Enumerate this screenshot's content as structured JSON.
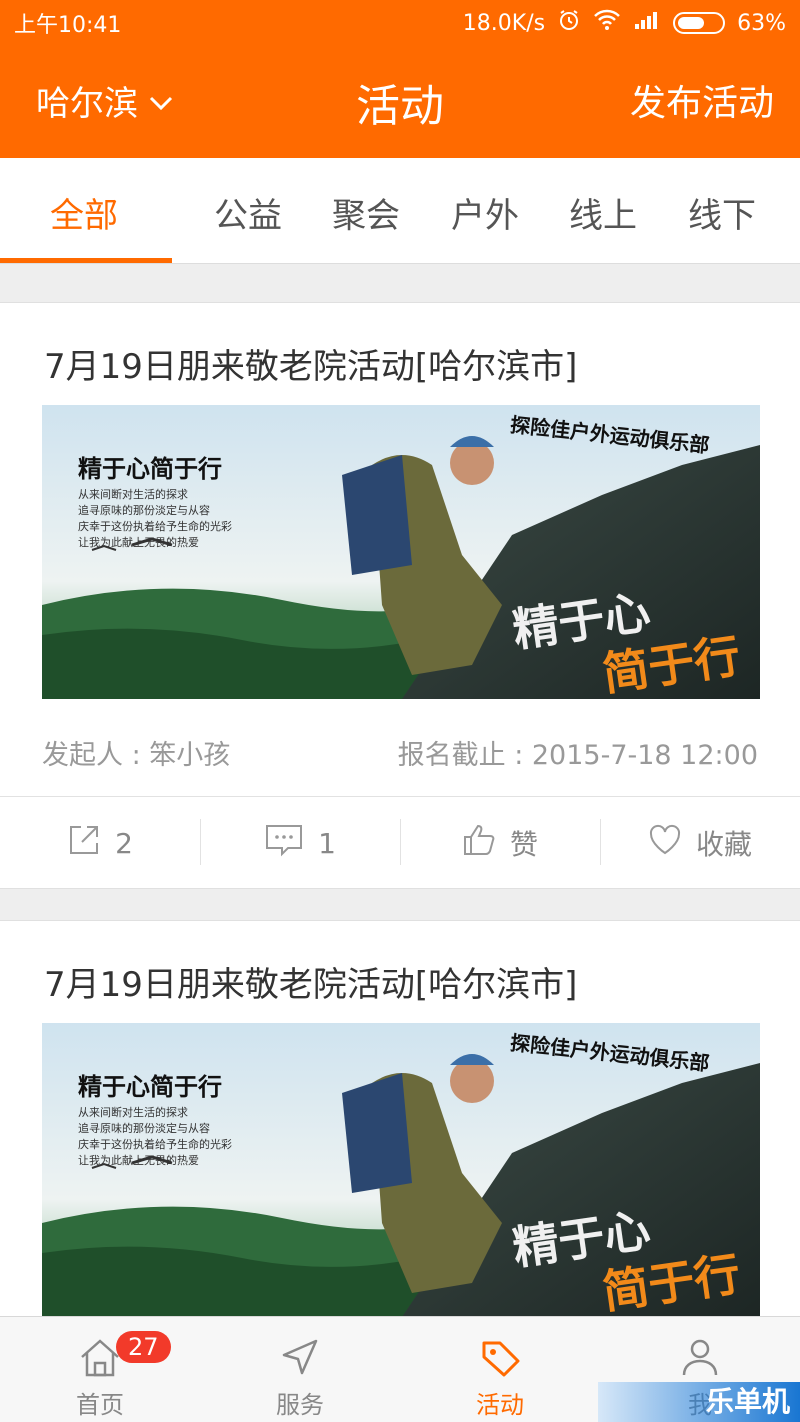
{
  "status_bar": {
    "time": "上午10:41",
    "speed": "18.0K/s",
    "battery": "63%",
    "battery_level": 0.63
  },
  "header": {
    "city": "哈尔滨",
    "title": "活动",
    "publish": "发布活动"
  },
  "tabs": [
    {
      "label": "全部"
    },
    {
      "label": "公益"
    },
    {
      "label": "聚会"
    },
    {
      "label": "户外"
    },
    {
      "label": "线上"
    },
    {
      "label": "线下"
    }
  ],
  "banner": {
    "club": "探险佳户外运动俱乐部",
    "slogan": "精于心简于行",
    "slogan_big_1": "精于心",
    "slogan_big_2": "简于行",
    "lines": [
      "从来间断对生活的探求",
      "追寻原味的那份淡定与从容",
      "庆幸于这份执着给予生命的光彩",
      "让我为此献上无畏的热爱"
    ]
  },
  "cards": [
    {
      "title": "7月19日朋来敬老院活动[哈尔滨市]",
      "organizer": "发起人 : 笨小孩",
      "deadline": "报名截止 : 2015-7-18 12:00",
      "share_count": "2",
      "comment_count": "1",
      "like_label": "赞",
      "favorite_label": "收藏"
    },
    {
      "title": "7月19日朋来敬老院活动[哈尔滨市]"
    }
  ],
  "tabbar": {
    "home": "首页",
    "home_badge": "27",
    "service": "服务",
    "activity": "活动",
    "me": "我"
  },
  "watermark": "乐单机",
  "colors": {
    "accent": "#ff6a00",
    "badge": "#f23a2a"
  }
}
